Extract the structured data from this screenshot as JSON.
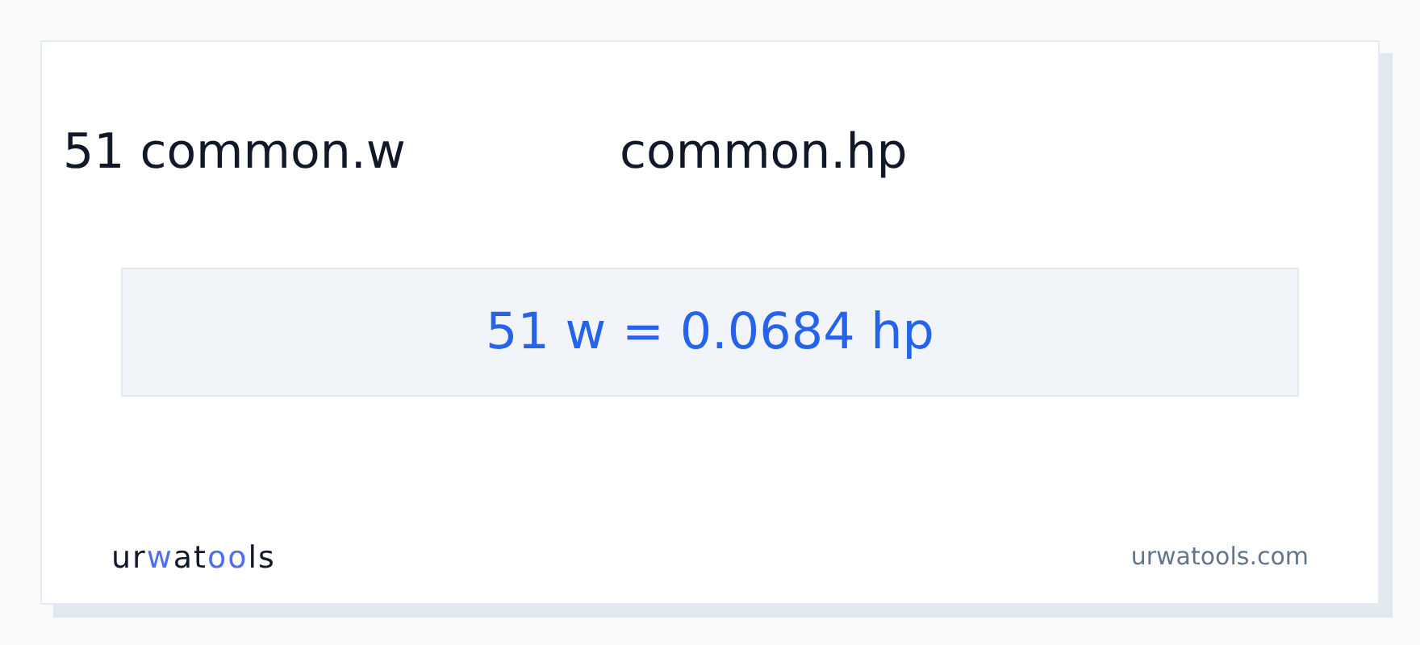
{
  "header": {
    "from": "51 common.w",
    "to": "common.hp"
  },
  "result": "51 w = 0.0684 hp",
  "footer": {
    "logo": [
      {
        "text": "ur",
        "accent": false
      },
      {
        "text": "w",
        "accent": true
      },
      {
        "text": "at",
        "accent": false
      },
      {
        "text": "oo",
        "accent": true
      },
      {
        "text": "ls",
        "accent": false
      }
    ],
    "site": "urwatools.com"
  }
}
